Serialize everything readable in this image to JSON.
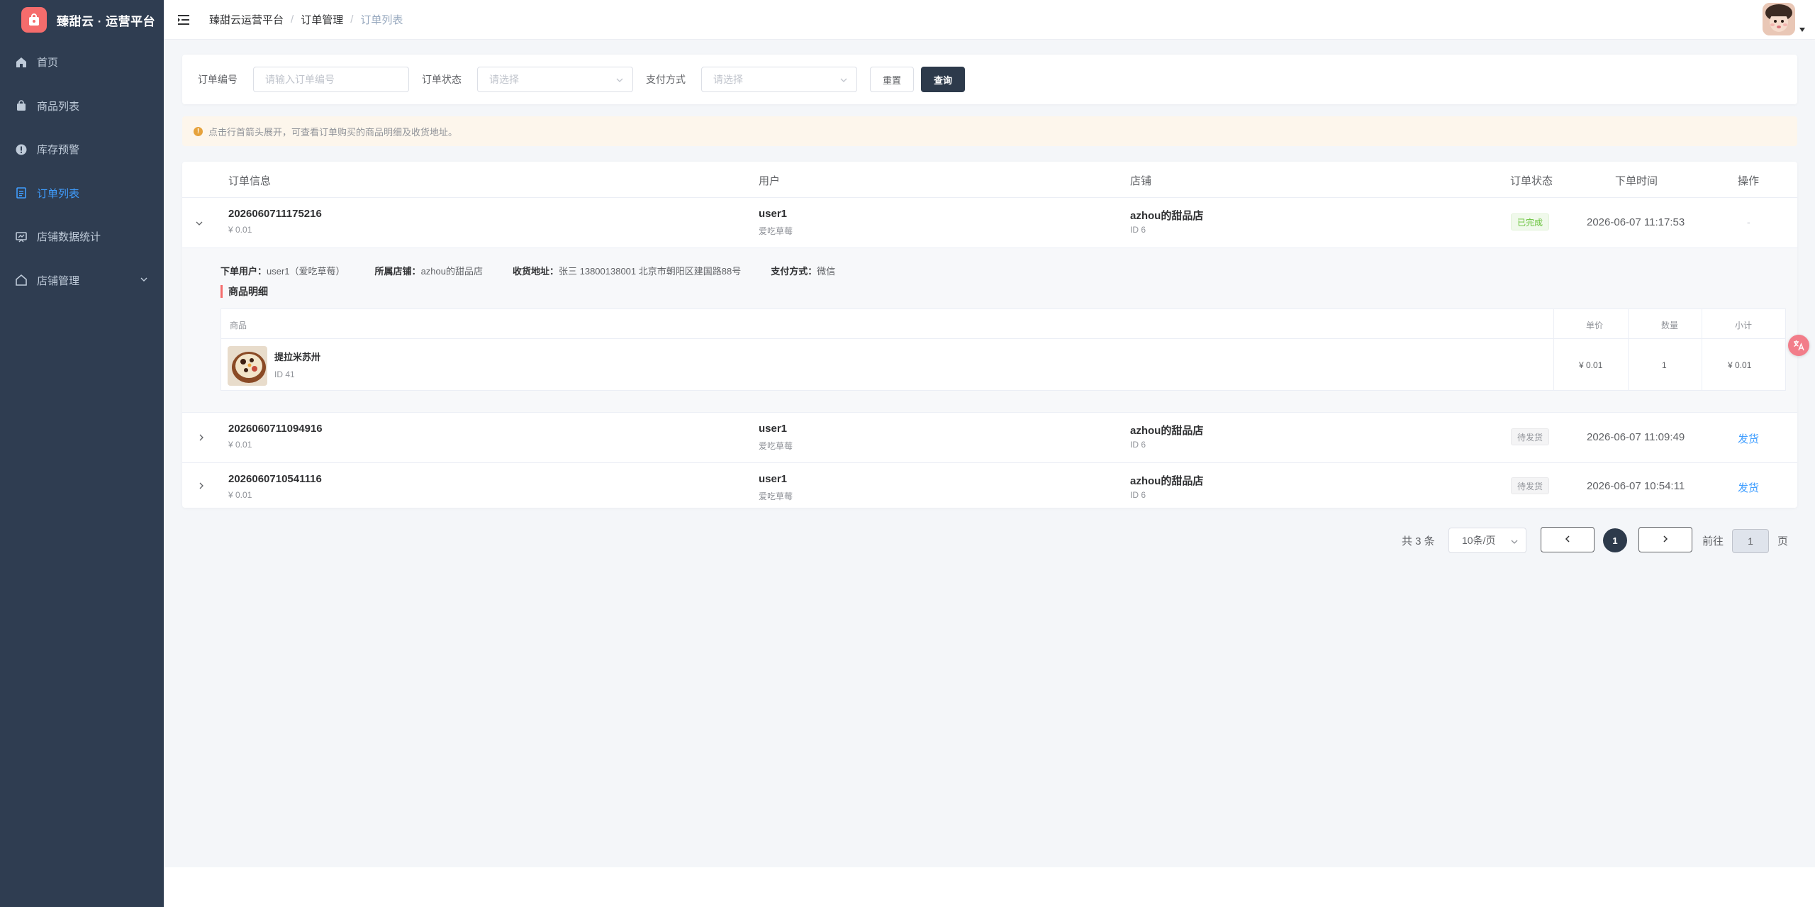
{
  "app": {
    "title": "臻甜云 · 运营平台"
  },
  "sidebar": {
    "items": [
      {
        "label": "首页",
        "icon": "home-icon"
      },
      {
        "label": "商品列表",
        "icon": "shopping-bag-icon"
      },
      {
        "label": "库存预警",
        "icon": "alert-circle-icon"
      },
      {
        "label": "订单列表",
        "icon": "document-icon",
        "active": true
      },
      {
        "label": "店铺数据统计",
        "icon": "chart-board-icon"
      },
      {
        "label": "店铺管理",
        "icon": "house-icon",
        "expandable": true
      }
    ]
  },
  "header": {
    "breadcrumb": [
      "臻甜云运营平台",
      "订单管理",
      "订单列表"
    ],
    "separator": "/"
  },
  "filters": {
    "order_no_label": "订单编号",
    "order_no_placeholder": "请输入订单编号",
    "status_label": "订单状态",
    "status_placeholder": "请选择",
    "pay_label": "支付方式",
    "pay_placeholder": "请选择",
    "reset_label": "重置",
    "query_label": "查询"
  },
  "tip": {
    "text": "点击行首箭头展开，可查看订单购买的商品明细及收货地址。"
  },
  "table": {
    "headers": {
      "order": "订单信息",
      "user": "用户",
      "shop": "店铺",
      "status": "订单状态",
      "time": "下单时间",
      "action": "操作"
    },
    "rows": [
      {
        "order_no": "2026060711175216",
        "amount": "¥ 0.01",
        "user": "user1",
        "nickname": "爱吃草莓",
        "shop": "azhou的甜品店",
        "shop_id": "ID 6",
        "status": "已完成",
        "time": "2026-06-07 11:17:53",
        "action": "-"
      },
      {
        "order_no": "2026060711094916",
        "amount": "¥ 0.01",
        "user": "user1",
        "nickname": "爱吃草莓",
        "shop": "azhou的甜品店",
        "shop_id": "ID 6",
        "status": "待发货",
        "time": "2026-06-07 11:09:49",
        "action": "发货"
      },
      {
        "order_no": "2026060710541116",
        "amount": "¥ 0.01",
        "user": "user1",
        "nickname": "爱吃草莓",
        "shop": "azhou的甜品店",
        "shop_id": "ID 6",
        "status": "待发货",
        "time": "2026-06-07 10:54:11",
        "action": "发货"
      }
    ],
    "expanded": {
      "buyer_key": "下单用户：",
      "buyer_val": "user1（爱吃草莓）",
      "shop_key": "所属店铺：",
      "shop_val": "azhou的甜品店",
      "address_key": "收货地址：",
      "address_val": "张三 13800138001 北京市朝阳区建国路88号",
      "pay_key": "支付方式：",
      "pay_val": "微信",
      "section_title": "商品明细",
      "headers": {
        "product": "商品",
        "price": "单价",
        "qty": "数量",
        "subtotal": "小计"
      },
      "items": [
        {
          "name": "提拉米苏卅",
          "id": "ID 41",
          "price": "¥ 0.01",
          "qty": "1",
          "subtotal": "¥ 0.01"
        }
      ]
    }
  },
  "pagination": {
    "total": "共 3 条",
    "page_size": "10条/页",
    "current": "1",
    "goto_label": "前往",
    "goto_value": "1",
    "page_suffix": "页"
  },
  "colors": {
    "sidebar_bg": "#2f3d51",
    "active": "#409eff",
    "brand_logo": "#f56c6c",
    "primary_dark": "#2d3a4b",
    "success": "#67c23a"
  }
}
